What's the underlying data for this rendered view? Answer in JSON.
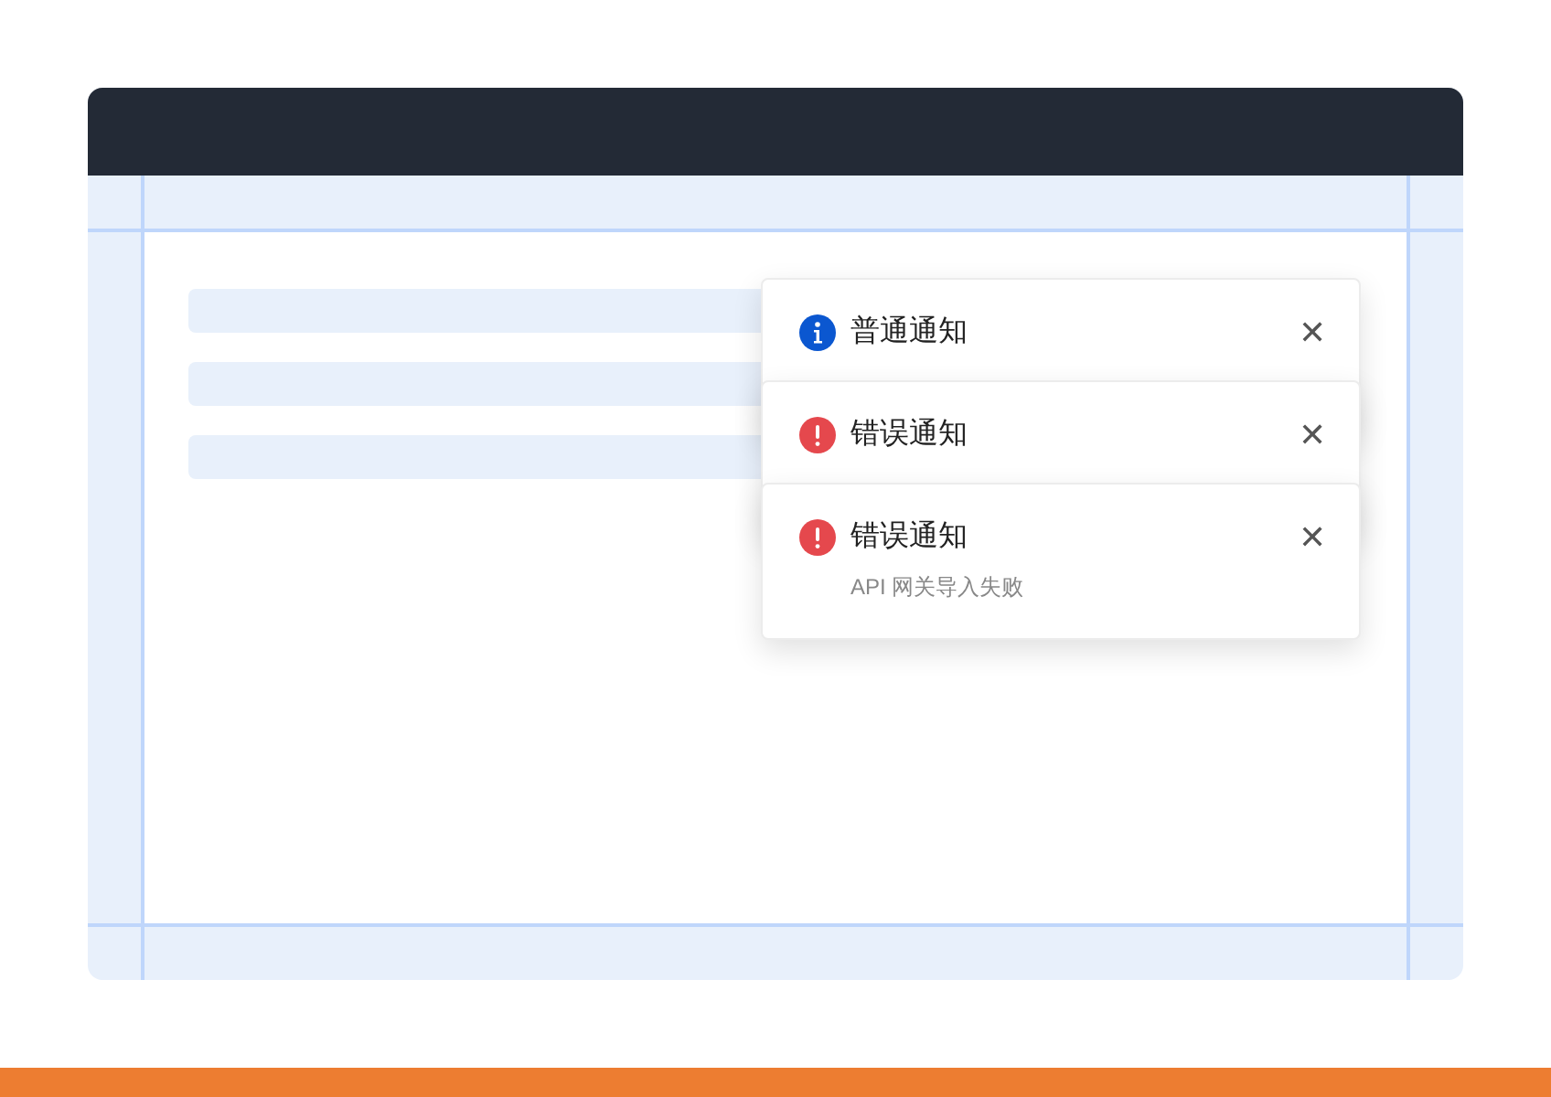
{
  "notifications": [
    {
      "kind": "info",
      "title": "普通通知"
    },
    {
      "kind": "error",
      "title": "错误通知"
    },
    {
      "kind": "error",
      "title": "错误通知",
      "message": "API 网关导入失败"
    }
  ],
  "close_symbol": "✕"
}
